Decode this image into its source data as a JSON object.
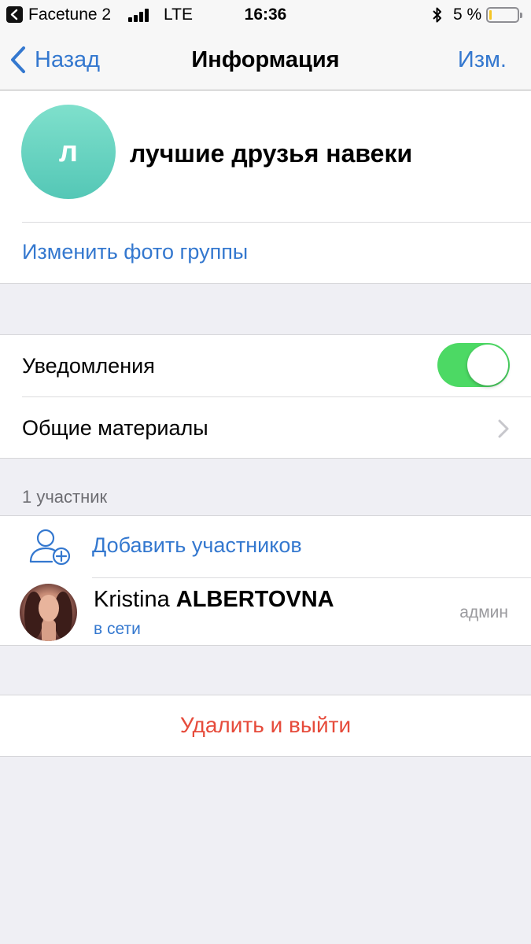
{
  "status_bar": {
    "app_name": "Facetune 2",
    "network": "LTE",
    "time": "16:36",
    "battery_text": "5 %"
  },
  "nav": {
    "back_label": "Назад",
    "title": "Информация",
    "edit_label": "Изм."
  },
  "group": {
    "avatar_letter": "л",
    "name": "лучшие друзья навеки",
    "change_photo_label": "Изменить фото группы"
  },
  "settings": {
    "notifications_label": "Уведомления",
    "notifications_enabled": true,
    "shared_media_label": "Общие материалы"
  },
  "members": {
    "header": "1 участник",
    "add_label": "Добавить участников",
    "list": [
      {
        "first_name": "Kristina",
        "last_name": "ALBERTOVNA",
        "status": "в сети",
        "role": "админ"
      }
    ]
  },
  "actions": {
    "leave_label": "Удалить и выйти"
  },
  "colors": {
    "accent": "#3478cf",
    "destructive": "#e64b3b",
    "toggle_on": "#4cd964",
    "avatar_gradient_top": "#7fe0cc",
    "avatar_gradient_bottom": "#54c7b6"
  }
}
